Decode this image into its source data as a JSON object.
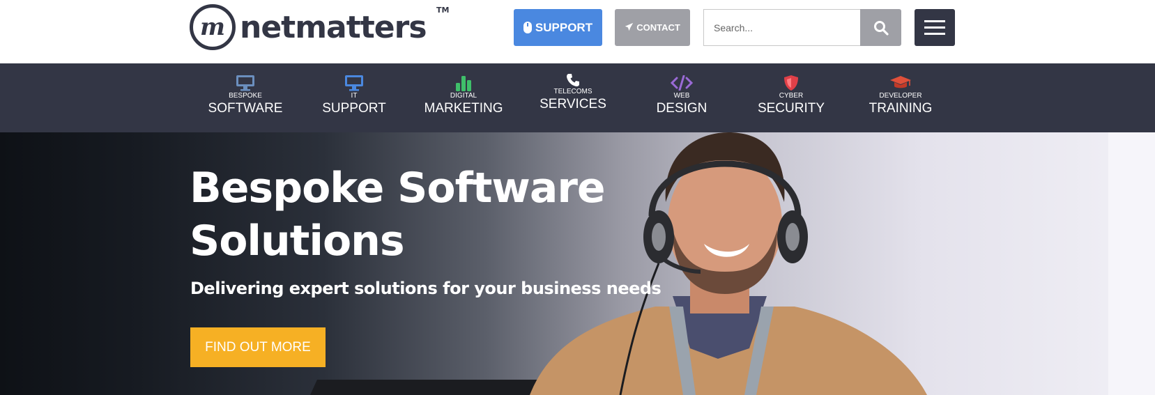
{
  "brand": {
    "name": "netmatters",
    "mark": "m",
    "trademark": "TM"
  },
  "header": {
    "support_label": "SUPPORT",
    "contact_label": "CONTACT",
    "search_placeholder": "Search..."
  },
  "nav": {
    "items": [
      {
        "small": "BESPOKE",
        "big": "SOFTWARE",
        "icon": "monitor-icon",
        "color": "#6b8fbe"
      },
      {
        "small": "IT",
        "big": "SUPPORT",
        "icon": "monitor-icon",
        "color": "#4a88e0"
      },
      {
        "small": "DIGITAL",
        "big": "MARKETING",
        "icon": "bar-chart-icon",
        "color": "#3fbf6a"
      },
      {
        "small": "TELECOMS",
        "big": "SERVICES",
        "icon": "phone-icon",
        "color": "#ffffff"
      },
      {
        "small": "WEB",
        "big": "DESIGN",
        "icon": "code-icon",
        "color": "#9a6ad6"
      },
      {
        "small": "CYBER",
        "big": "SECURITY",
        "icon": "shield-icon",
        "color": "#e04048"
      },
      {
        "small": "DEVELOPER",
        "big": "TRAINING",
        "icon": "graduation-cap-icon",
        "color": "#e0503a"
      }
    ]
  },
  "hero": {
    "title": "Bespoke Software Solutions",
    "subtitle": "Delivering expert solutions for your business needs",
    "cta_label": "FIND OUT MORE"
  },
  "colors": {
    "dark": "#333645",
    "support_blue": "#4a88e0",
    "contact_grey": "#9fa0a6",
    "cta_yellow": "#f6b024"
  }
}
